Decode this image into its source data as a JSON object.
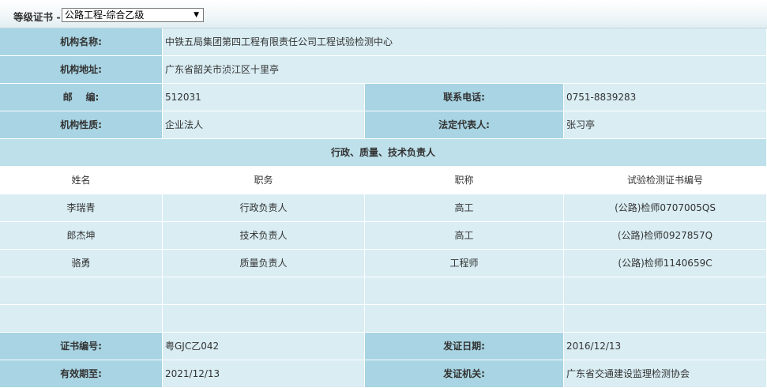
{
  "header": {
    "label": "等级证书",
    "dropdown_value": "公路工程-综合乙级"
  },
  "info": {
    "org_name_label": "机构名称:",
    "org_name": "中铁五局集团第四工程有限责任公司工程试验检测中心",
    "address_label": "机构地址:",
    "address": "广东省韶关市浈江区十里亭",
    "postcode_label": "邮    编:",
    "postcode": "512031",
    "phone_label": "联系电话:",
    "phone": "0751-8839283",
    "nature_label": "机构性质:",
    "nature": "企业法人",
    "legal_rep_label": "法定代表人:",
    "legal_rep": "张习亭"
  },
  "section_title": "行政、质量、技术负责人",
  "staff": {
    "headers": [
      "姓名",
      "职务",
      "职称",
      "试验检测证书编号"
    ],
    "rows": [
      [
        "李瑞青",
        "行政负责人",
        "高工",
        "(公路)检师0707005QS"
      ],
      [
        "郎杰坤",
        "技术负责人",
        "高工",
        "(公路)检师0927857Q"
      ],
      [
        "骆勇",
        "质量负责人",
        "工程师",
        "(公路)检师1140659C"
      ]
    ]
  },
  "cert": {
    "number_label": "证书编号:",
    "number": "粤GJC乙042",
    "issue_date_label": "发证日期:",
    "issue_date": "2016/12/13",
    "valid_until_label": "有效期至:",
    "valid_until": "2021/12/13",
    "issuer_label": "发证机关:",
    "issuer": "广东省交通建设监理检测协会"
  }
}
